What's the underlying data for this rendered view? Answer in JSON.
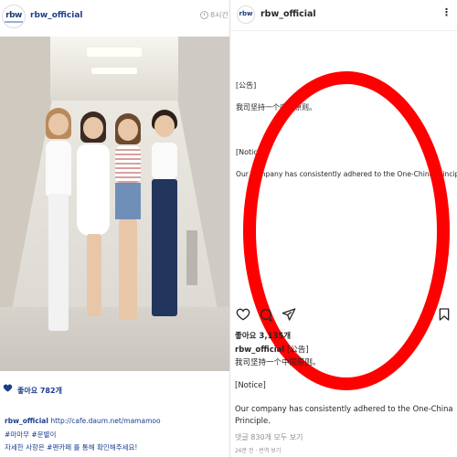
{
  "left_post": {
    "account": "rbw_official",
    "logo_text": "rbw",
    "time": "8시간",
    "likes": "좋아요 782개",
    "caption_user": "rbw_official",
    "caption_link": "http://cafe.daum.net/mamamoo",
    "tags_line": "#마마무 #문별이",
    "last_line": "자세한 사항은 #팬카페 를 통해 확인해주세요!"
  },
  "right_post": {
    "account": "rbw_official",
    "logo_text": "rbw",
    "more_icon": "ellipsis-icon",
    "body": {
      "notice_cn_tag": "[公告]",
      "notice_cn_text": "我司坚持一个中国原则。",
      "notice_en_tag": "[Notice]",
      "notice_en_text": "Our company has consistently adhered to the One-China Principle."
    },
    "icons": [
      "heart-icon",
      "comment-icon",
      "share-icon",
      "bookmark-icon"
    ],
    "likes": "좋아요 3,135개",
    "caption_user": "rbw_official",
    "caption_tag": "[公告]",
    "caption_cn": "我司坚持一个中国原则。",
    "caption_notice": "[Notice]",
    "caption_en_1": "Our company has consistently adhered to the One-China",
    "caption_en_2": "Principle.",
    "view_comments": "댓글 830개 모두 보기",
    "meta": "26분 전 · 번역 보기"
  },
  "colors": {
    "highlight_ring": "#ff0000",
    "left_accent": "#1c3d8f"
  }
}
